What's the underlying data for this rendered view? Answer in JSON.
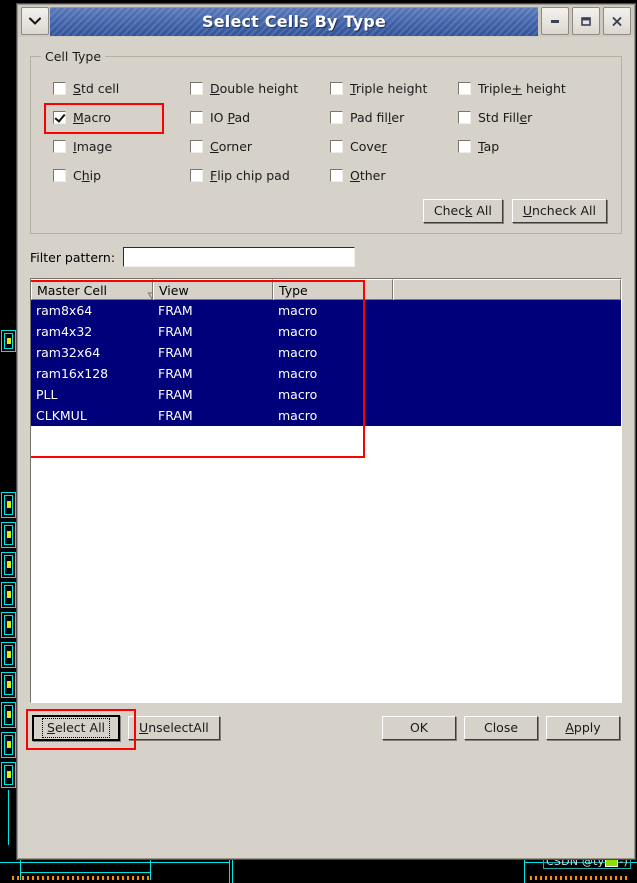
{
  "window": {
    "title": "Select Cells By Type",
    "menu_icon": "chevron-down-icon",
    "minimize_label": "–",
    "maximize_label": "□",
    "close_label": "✕"
  },
  "cell_type_group": {
    "title": "Cell Type",
    "checkboxes": [
      {
        "label": "Std cell",
        "mnemonic": "S",
        "checked": false
      },
      {
        "label": "Double height",
        "mnemonic": "D",
        "checked": false
      },
      {
        "label": "Triple height",
        "mnemonic": "T",
        "checked": false
      },
      {
        "label": "Triple+ height",
        "mnemonic": "+",
        "checked": false
      },
      {
        "label": "Macro",
        "mnemonic": "M",
        "checked": true
      },
      {
        "label": "IO Pad",
        "mnemonic": "P",
        "checked": false
      },
      {
        "label": "Pad filler",
        "mnemonic": "l",
        "checked": false
      },
      {
        "label": "Std Filler",
        "mnemonic": "e",
        "checked": false
      },
      {
        "label": "Image",
        "mnemonic": "I",
        "checked": false
      },
      {
        "label": "Corner",
        "mnemonic": "C",
        "checked": false
      },
      {
        "label": "Cover",
        "mnemonic": "r",
        "checked": false
      },
      {
        "label": "Tap",
        "mnemonic": "T",
        "checked": false
      },
      {
        "label": "Chip",
        "mnemonic": "h",
        "checked": false
      },
      {
        "label": "Flip chip pad",
        "mnemonic": "F",
        "checked": false
      },
      {
        "label": "Other",
        "mnemonic": "O",
        "checked": false
      }
    ],
    "check_all_label": "Check All",
    "check_all_mnemonic": "k",
    "uncheck_all_label": "Uncheck All",
    "uncheck_all_mnemonic": "U"
  },
  "filter": {
    "label": "Filter pattern:",
    "value": "",
    "placeholder": ""
  },
  "table": {
    "columns": [
      "Master Cell",
      "View",
      "Type",
      ""
    ],
    "sort_column": "Master Cell",
    "sort_icon": "sort-descending-triangle-icon",
    "rows": [
      {
        "master_cell": "ram8x64",
        "view": "FRAM",
        "type": "macro",
        "selected": true
      },
      {
        "master_cell": "ram4x32",
        "view": "FRAM",
        "type": "macro",
        "selected": true
      },
      {
        "master_cell": "ram32x64",
        "view": "FRAM",
        "type": "macro",
        "selected": true
      },
      {
        "master_cell": "ram16x128",
        "view": "FRAM",
        "type": "macro",
        "selected": true
      },
      {
        "master_cell": "PLL",
        "view": "FRAM",
        "type": "macro",
        "selected": true
      },
      {
        "master_cell": "CLKMUL",
        "view": "FRAM",
        "type": "macro",
        "selected": true
      }
    ]
  },
  "footer": {
    "select_all_label": "Select All",
    "select_all_mnemonic": "S",
    "unselect_all_label": "UnselectAll",
    "unselect_all_mnemonic": "U",
    "ok_label": "OK",
    "close_label": "Close",
    "apply_label": "Apply",
    "apply_mnemonic": "A"
  },
  "watermark": {
    "text_before": "CSDN @ty",
    "text_after": "-)"
  },
  "colors": {
    "selection_blue": "#00007b",
    "titlebar_blue": "#4466ac",
    "dialog_face": "#d6d2ca",
    "annotation_red": "#ff0000",
    "layout_cyan": "#00e5e5",
    "layout_yellow": "#e8e800"
  }
}
